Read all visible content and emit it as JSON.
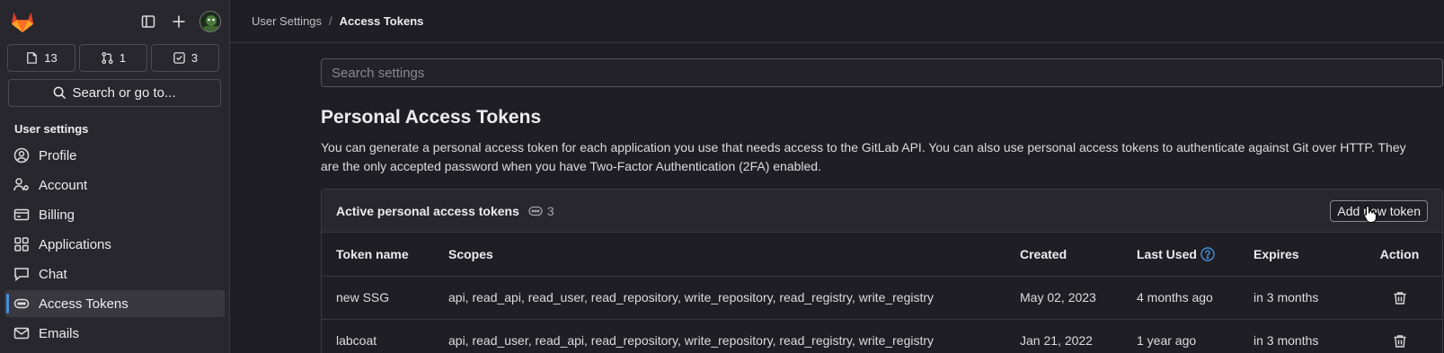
{
  "sidebar": {
    "counters": [
      {
        "icon": "issues-icon",
        "count": "13"
      },
      {
        "icon": "merge-request-icon",
        "count": "1"
      },
      {
        "icon": "todo-icon",
        "count": "3"
      }
    ],
    "search_label": "Search or go to...",
    "section_title": "User settings",
    "items": [
      {
        "label": "Profile",
        "icon": "profile-icon"
      },
      {
        "label": "Account",
        "icon": "account-icon"
      },
      {
        "label": "Billing",
        "icon": "billing-icon"
      },
      {
        "label": "Applications",
        "icon": "applications-icon"
      },
      {
        "label": "Chat",
        "icon": "chat-icon"
      },
      {
        "label": "Access Tokens",
        "icon": "token-icon",
        "active": true
      },
      {
        "label": "Emails",
        "icon": "mail-icon"
      }
    ]
  },
  "breadcrumb": {
    "parent": "User Settings",
    "separator": "/",
    "current": "Access Tokens"
  },
  "settings_search": {
    "placeholder": "Search settings"
  },
  "page": {
    "title": "Personal Access Tokens",
    "description": "You can generate a personal access token for each application you use that needs access to the GitLab API. You can also use personal access tokens to authenticate against Git over HTTP. They are the only accepted password when you have Two-Factor Authentication (2FA) enabled."
  },
  "tokens_card": {
    "title": "Active personal access tokens",
    "count": "3",
    "add_button": "Add new token",
    "columns": {
      "name": "Token name",
      "scopes": "Scopes",
      "created": "Created",
      "last_used": "Last Used",
      "expires": "Expires",
      "action": "Action"
    },
    "rows": [
      {
        "name": "new SSG",
        "scopes": "api, read_api, read_user, read_repository, write_repository, read_registry, write_registry",
        "created": "May 02, 2023",
        "last_used": "4 months ago",
        "expires": "in 3 months"
      },
      {
        "name": "labcoat",
        "scopes": "api, read_user, read_api, read_repository, write_repository, read_registry, write_registry",
        "created": "Jan 21, 2022",
        "last_used": "1 year ago",
        "expires": "in 3 months"
      }
    ]
  },
  "colors": {
    "background": "#1f1e24",
    "sidebar": "#28272d",
    "accent": "#428fdc",
    "logo_orange": "#fc6d26"
  }
}
